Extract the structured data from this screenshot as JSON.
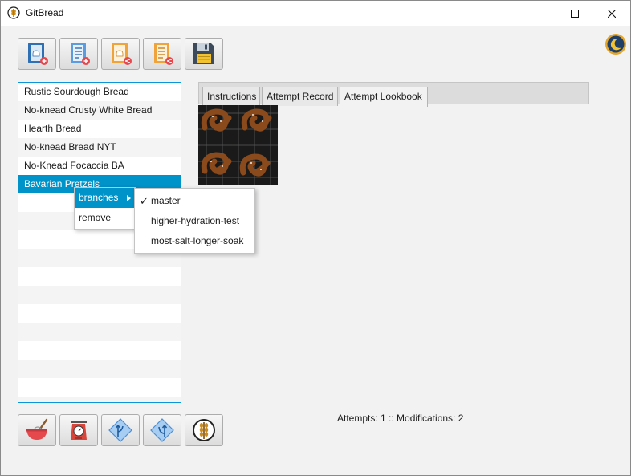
{
  "window": {
    "title": "GitBread",
    "app_icon": "wheat-logo-icon"
  },
  "toolbar_top": [
    {
      "name": "new-recipe-button",
      "icon": "recipe-book-add-icon"
    },
    {
      "name": "new-list-button",
      "icon": "list-add-icon"
    },
    {
      "name": "share-recipe-button",
      "icon": "recipe-share-icon"
    },
    {
      "name": "share-list-button",
      "icon": "list-share-icon"
    },
    {
      "name": "save-button",
      "icon": "floppy-disk-icon"
    }
  ],
  "theme_toggle": {
    "icon": "moon-icon"
  },
  "recipes": [
    "Rustic Sourdough Bread",
    "No-knead Crusty White Bread",
    "Hearth Bread",
    "No-knead Bread NYT",
    "No-Knead Focaccia BA",
    "Bavarian Pretzels"
  ],
  "tabs": [
    "Instructions",
    "Attempt Record",
    "Attempt Lookbook"
  ],
  "active_tab": "Attempt Lookbook",
  "context_menu": {
    "items": [
      "branches",
      "remove"
    ],
    "branches_submenu": [
      "master",
      "higher-hydration-test",
      "most-salt-longer-soak"
    ],
    "checked": "master"
  },
  "status": "Attempts: 1 :: Modifications: 2",
  "toolbar_bottom": [
    {
      "name": "mix-button",
      "icon": "mixing-bowl-icon"
    },
    {
      "name": "scale-button",
      "icon": "kitchen-scale-icon"
    },
    {
      "name": "branch-button",
      "icon": "git-branch-icon"
    },
    {
      "name": "merge-button",
      "icon": "git-merge-icon"
    },
    {
      "name": "gitbread-button",
      "icon": "wheat-logo-icon"
    }
  ],
  "colors": {
    "accent": "#0093c9",
    "list_border": "#0a96d8"
  }
}
